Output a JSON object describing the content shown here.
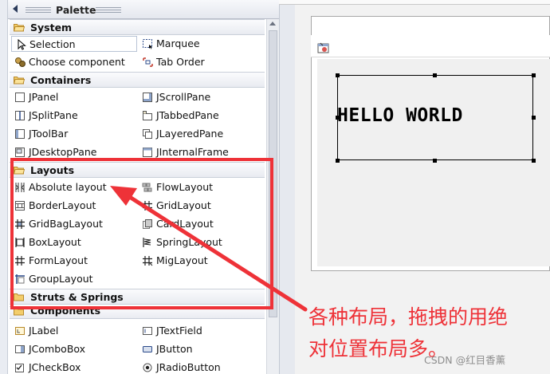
{
  "palette": {
    "title": "Palette",
    "categories": [
      {
        "label": "System",
        "items": [
          {
            "label": "Selection",
            "icon": "cursor-arrow-icon",
            "selected": true
          },
          {
            "label": "Marquee",
            "icon": "marquee-icon"
          },
          {
            "label": "Choose component",
            "icon": "choose-component-icon"
          },
          {
            "label": "Tab Order",
            "icon": "tab-order-icon"
          }
        ]
      },
      {
        "label": "Containers",
        "items": [
          {
            "label": "JPanel",
            "icon": "jpanel-icon"
          },
          {
            "label": "JScrollPane",
            "icon": "jscrollpane-icon"
          },
          {
            "label": "JSplitPane",
            "icon": "jsplitpane-icon"
          },
          {
            "label": "JTabbedPane",
            "icon": "jtabbedpane-icon"
          },
          {
            "label": "JToolBar",
            "icon": "jtoolbar-icon"
          },
          {
            "label": "JLayeredPane",
            "icon": "jlayeredpane-icon"
          },
          {
            "label": "JDesktopPane",
            "icon": "jdesktoppane-icon"
          },
          {
            "label": "JInternalFrame",
            "icon": "jinternalframe-icon"
          }
        ]
      },
      {
        "label": "Layouts",
        "items": [
          {
            "label": "Absolute layout",
            "icon": "absolute-layout-icon"
          },
          {
            "label": "FlowLayout",
            "icon": "flowlayout-icon"
          },
          {
            "label": "BorderLayout",
            "icon": "borderlayout-icon"
          },
          {
            "label": "GridLayout",
            "icon": "gridlayout-icon"
          },
          {
            "label": "GridBagLayout",
            "icon": "gridbaglayout-icon"
          },
          {
            "label": "CardLayout",
            "icon": "cardlayout-icon"
          },
          {
            "label": "BoxLayout",
            "icon": "boxlayout-icon"
          },
          {
            "label": "SpringLayout",
            "icon": "springlayout-icon"
          },
          {
            "label": "FormLayout",
            "icon": "formlayout-icon"
          },
          {
            "label": "MigLayout",
            "icon": "miglayout-icon"
          },
          {
            "label": "GroupLayout",
            "icon": "grouplayout-icon"
          }
        ]
      },
      {
        "label": "Struts & Springs",
        "items": []
      },
      {
        "label": "Components",
        "items": [
          {
            "label": "JLabel",
            "icon": "jlabel-icon"
          },
          {
            "label": "JTextField",
            "icon": "jtextfield-icon"
          },
          {
            "label": "JComboBox",
            "icon": "jcombobox-icon"
          },
          {
            "label": "JButton",
            "icon": "jbutton-icon"
          },
          {
            "label": "JCheckBox",
            "icon": "jcheckbox-icon"
          },
          {
            "label": "JRadioButton",
            "icon": "jradiobutton-icon"
          }
        ]
      }
    ]
  },
  "design": {
    "label_text": "HELLO WORLD",
    "frame_icon": "java-frame-icon"
  },
  "annotation": {
    "line1": "各种布局，拖拽的用绝",
    "line2": "对位置布局多。",
    "color": "#ee3238"
  },
  "watermark": "CSDN @红目香薰"
}
